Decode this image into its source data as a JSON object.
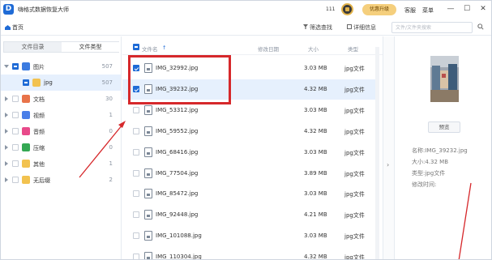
{
  "app": {
    "title": "嗨格式数据恢复大师",
    "coins": "111",
    "upgrade_label": "优惠升级",
    "service_label": "客服",
    "menu_label": "菜单",
    "min_glyph": "—",
    "max_glyph": "☐",
    "close_glyph": "✕"
  },
  "nav": {
    "home_label": "首页",
    "filter_label": "筛选查找",
    "details_label": "详细信息",
    "search_placeholder": "文件/文件夹搜索"
  },
  "left": {
    "tabs": [
      {
        "label": "文件目录",
        "active": false
      },
      {
        "label": "文件类型",
        "active": true
      }
    ],
    "tree": [
      {
        "label": "图片",
        "count": "507",
        "level": 0,
        "expanded": true,
        "checked": "partial",
        "icon_color": "#3b7be0",
        "selected": false
      },
      {
        "label": "jpg",
        "count": "507",
        "level": 1,
        "expanded": false,
        "checked": "partial",
        "icon_color": "#f2c24f",
        "selected": true
      },
      {
        "label": "文档",
        "count": "30",
        "level": 0,
        "expanded": false,
        "checked": "none",
        "icon_color": "#e8734a",
        "selected": false
      },
      {
        "label": "视频",
        "count": "1",
        "level": 0,
        "expanded": false,
        "checked": "none",
        "icon_color": "#4a7fe8",
        "selected": false
      },
      {
        "label": "音频",
        "count": "0",
        "level": 0,
        "expanded": false,
        "checked": "none",
        "icon_color": "#e84a8a",
        "selected": false
      },
      {
        "label": "压缩",
        "count": "0",
        "level": 0,
        "expanded": false,
        "checked": "none",
        "icon_color": "#34a853",
        "selected": false
      },
      {
        "label": "其他",
        "count": "1",
        "level": 0,
        "expanded": false,
        "checked": "none",
        "icon_color": "#f2c24f",
        "selected": false
      },
      {
        "label": "无后缀",
        "count": "2",
        "level": 0,
        "expanded": false,
        "checked": "none",
        "icon_color": "#f2c24f",
        "selected": false
      }
    ]
  },
  "list": {
    "columns": {
      "name": "文件名",
      "modified": "修改日期",
      "size": "大小",
      "type": "类型"
    },
    "rows": [
      {
        "name": "IMG_32992.jpg",
        "size": "3.03 MB",
        "type": "jpg文件",
        "checked": true,
        "selected": false
      },
      {
        "name": "IMG_39232.jpg",
        "size": "4.32 MB",
        "type": "jpg文件",
        "checked": true,
        "selected": true
      },
      {
        "name": "IMG_53312.jpg",
        "size": "3.03 MB",
        "type": "jpg文件",
        "checked": false,
        "selected": false
      },
      {
        "name": "IMG_59552.jpg",
        "size": "4.32 MB",
        "type": "jpg文件",
        "checked": false,
        "selected": false
      },
      {
        "name": "IMG_68416.jpg",
        "size": "3.03 MB",
        "type": "jpg文件",
        "checked": false,
        "selected": false
      },
      {
        "name": "IMG_77504.jpg",
        "size": "3.89 MB",
        "type": "jpg文件",
        "checked": false,
        "selected": false
      },
      {
        "name": "IMG_85472.jpg",
        "size": "3.03 MB",
        "type": "jpg文件",
        "checked": false,
        "selected": false
      },
      {
        "name": "IMG_92448.jpg",
        "size": "4.21 MB",
        "type": "jpg文件",
        "checked": false,
        "selected": false
      },
      {
        "name": "IMG_101088.jpg",
        "size": "3.03 MB",
        "type": "jpg文件",
        "checked": false,
        "selected": false
      },
      {
        "name": "IMG_110304.jpg",
        "size": "4.32 MB",
        "type": "jpg文件",
        "checked": false,
        "selected": false
      }
    ]
  },
  "preview": {
    "button_label": "预览",
    "name_line": "名称:IMG_39232.jpg",
    "size_line": "大小:4.32 MB",
    "type_line": "类型:jpg文件",
    "modified_line": "修改时间:",
    "collapse_glyph": "›"
  },
  "colors": {
    "accent": "#1f6bd6",
    "selection": "#e6f0fd",
    "annotation_red": "#d6282b",
    "upgrade_gold": "#f5cf7d"
  }
}
